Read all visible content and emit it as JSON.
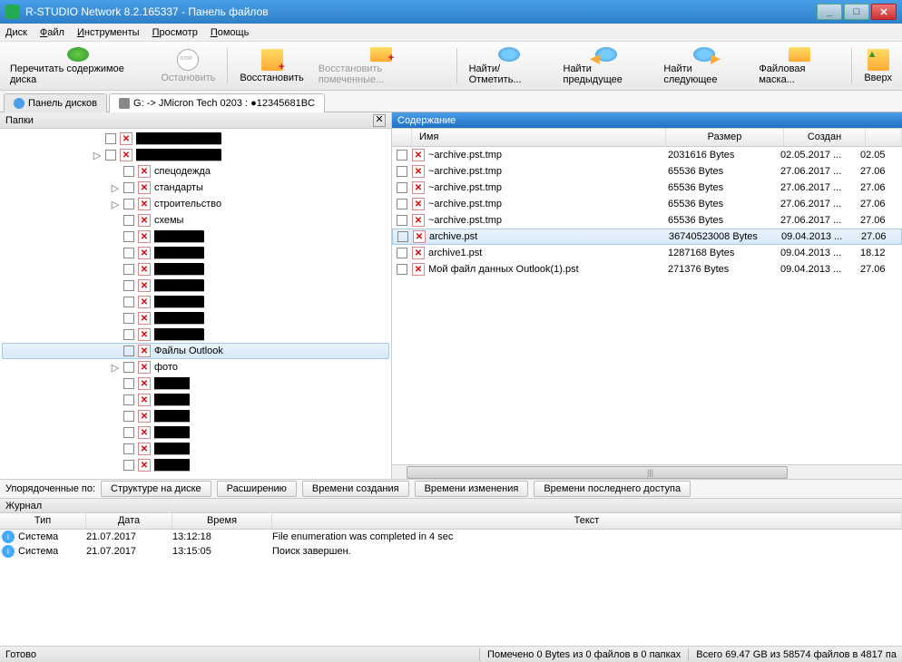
{
  "window": {
    "title": "R-STUDIO Network 8.2.165337 - Панель файлов"
  },
  "menu": {
    "disk": "Диск",
    "file": "Файл",
    "tools": "Инструменты",
    "view": "Просмотр",
    "help": "Помощь"
  },
  "toolbar": {
    "reread": "Перечитать содержимое диска",
    "stop": "Остановить",
    "recover": "Восстановить",
    "recover_marked": "Восстановить помеченные...",
    "find": "Найти/Отметить...",
    "find_prev": "Найти предыдущее",
    "find_next": "Найти следующее",
    "file_mask": "Файловая маска...",
    "up": "Вверх"
  },
  "tabs": {
    "disks": "Панель дисков",
    "drive": "G: -> JMicron Tech 0203 : ●12345681BC"
  },
  "left": {
    "header": "Папки",
    "items": [
      {
        "label": "████████████",
        "redact": true,
        "lvl": 1
      },
      {
        "label": "████████████",
        "redact": true,
        "lvl": 1,
        "exp": "▷"
      },
      {
        "label": "спецодежда",
        "lvl": 2
      },
      {
        "label": "стандарты",
        "lvl": 2,
        "exp": "▷"
      },
      {
        "label": "строительство",
        "lvl": 2,
        "exp": "▷"
      },
      {
        "label": "схемы",
        "lvl": 2
      },
      {
        "label": "███████",
        "redact": true,
        "lvl": 2
      },
      {
        "label": "███████",
        "redact": true,
        "lvl": 2
      },
      {
        "label": "███████",
        "redact": true,
        "lvl": 2
      },
      {
        "label": "███████",
        "redact": true,
        "lvl": 2
      },
      {
        "label": "███████",
        "redact": true,
        "lvl": 2
      },
      {
        "label": "███████",
        "redact": true,
        "lvl": 2
      },
      {
        "label": "███████",
        "redact": true,
        "lvl": 2
      },
      {
        "label": "Файлы Outlook",
        "lvl": 2,
        "sel": true
      },
      {
        "label": "фото",
        "lvl": 2,
        "exp": "▷"
      },
      {
        "label": "█████",
        "redact": true,
        "lvl": 2
      },
      {
        "label": "█████",
        "redact": true,
        "lvl": 2
      },
      {
        "label": "█████",
        "redact": true,
        "lvl": 2
      },
      {
        "label": "█████",
        "redact": true,
        "lvl": 2
      },
      {
        "label": "█████",
        "redact": true,
        "lvl": 2
      },
      {
        "label": "█████",
        "redact": true,
        "lvl": 2
      }
    ]
  },
  "right": {
    "header": "Содержание",
    "cols": {
      "name": "Имя",
      "size": "Размер",
      "created": "Создан"
    },
    "rows": [
      {
        "name": "~archive.pst.tmp",
        "size": "2031616 Bytes",
        "created": "02.05.2017 ...",
        "mod": "02.05"
      },
      {
        "name": "~archive.pst.tmp",
        "size": "65536 Bytes",
        "created": "27.06.2017 ...",
        "mod": "27.06"
      },
      {
        "name": "~archive.pst.tmp",
        "size": "65536 Bytes",
        "created": "27.06.2017 ...",
        "mod": "27.06"
      },
      {
        "name": "~archive.pst.tmp",
        "size": "65536 Bytes",
        "created": "27.06.2017 ...",
        "mod": "27.06"
      },
      {
        "name": "~archive.pst.tmp",
        "size": "65536 Bytes",
        "created": "27.06.2017 ...",
        "mod": "27.06"
      },
      {
        "name": "archive.pst",
        "size": "36740523008 Bytes",
        "created": "09.04.2013 ...",
        "mod": "27.06",
        "sel": true
      },
      {
        "name": "archive1.pst",
        "size": "1287168 Bytes",
        "created": "09.04.2013 ...",
        "mod": "18.12"
      },
      {
        "name": "Мой файл данных Outlook(1).pst",
        "size": "271376 Bytes",
        "created": "09.04.2013 ...",
        "mod": "27.06"
      }
    ]
  },
  "sort": {
    "label": "Упорядоченные по:",
    "by_struct": "Структуре на диске",
    "by_ext": "Расширению",
    "by_ctime": "Времени создания",
    "by_mtime": "Времени изменения",
    "by_atime": "Времени последнего доступа"
  },
  "log": {
    "header": "Журнал",
    "cols": {
      "type": "Тип",
      "date": "Дата",
      "time": "Время",
      "text": "Текст"
    },
    "rows": [
      {
        "type": "Система",
        "date": "21.07.2017",
        "time": "13:12:18",
        "text": "File enumeration was completed in 4 sec"
      },
      {
        "type": "Система",
        "date": "21.07.2017",
        "time": "13:15:05",
        "text": "Поиск завершен."
      }
    ]
  },
  "status": {
    "ready": "Готово",
    "marked": "Помечено 0 Bytes из 0 файлов в 0 папках",
    "total": "Всего 69.47 GB из 58574 файлов в 4817 па"
  }
}
